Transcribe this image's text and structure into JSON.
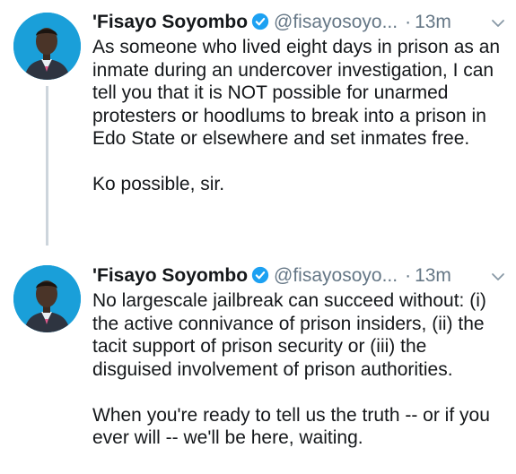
{
  "tweets": [
    {
      "name": "'Fisayo Soyombo",
      "handle": "@fisayosoyo...",
      "time": "13m",
      "dot": "·",
      "paragraphs": [
        "As someone who lived eight days in prison as an inmate during an undercover investigation, I can tell you that it is NOT possible for unarmed protesters or hoodlums to break into a prison in Edo State or elsewhere and set inmates free.",
        "Ko possible, sir."
      ]
    },
    {
      "name": "'Fisayo Soyombo",
      "handle": "@fisayosoyo...",
      "time": "13m",
      "dot": "·",
      "paragraphs": [
        "No largescale jailbreak can succeed without: (i) the active connivance of prison insiders, (ii) the tacit support of prison security or (iii) the disguised involvement of prison authorities.",
        "When you're ready to tell us the truth -- or if you ever will -- we'll be here, waiting."
      ]
    }
  ],
  "colors": {
    "text": "#14171a",
    "muted": "#657786",
    "verified_blue": "#1da1f2",
    "avatar_bg": "#1a9fd9",
    "thread_line": "#cdd5dc"
  },
  "icons": {
    "verified": "verified-badge-icon",
    "more": "chevron-down-icon"
  }
}
